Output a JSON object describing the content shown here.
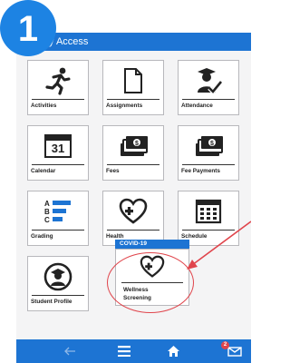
{
  "step_badge": "1",
  "header": {
    "title": "y Access"
  },
  "tiles": [
    {
      "label": "Activities",
      "icon": "running-person-icon"
    },
    {
      "label": "Assignments",
      "icon": "document-icon"
    },
    {
      "label": "Attendance",
      "icon": "teacher-check-icon"
    },
    {
      "label": "Calendar",
      "icon": "calendar-icon",
      "icon_text": "31"
    },
    {
      "label": "Fees",
      "icon": "money-stack-icon"
    },
    {
      "label": "Fee Payments",
      "icon": "money-stack-icon"
    },
    {
      "label": "Grading",
      "icon": "grades-list-icon",
      "grade_letters": [
        "A",
        "B",
        "C"
      ]
    },
    {
      "label": "Health",
      "icon": "heart-plus-icon"
    },
    {
      "label": "Schedule",
      "icon": "schedule-grid-icon"
    },
    {
      "label": "Student Profile",
      "icon": "student-avatar-icon"
    }
  ],
  "covid": {
    "section": "COVID-19",
    "label": "Wellness Screening",
    "icon": "heart-plus-icon"
  },
  "bottom_bar": {
    "items": [
      "back-arrow-icon",
      "menu-icon",
      "home-icon",
      "mail-icon"
    ],
    "mail_badge": "2"
  },
  "colors": {
    "brand_blue": "#1d74d3",
    "annotation_red": "#e0454c"
  }
}
